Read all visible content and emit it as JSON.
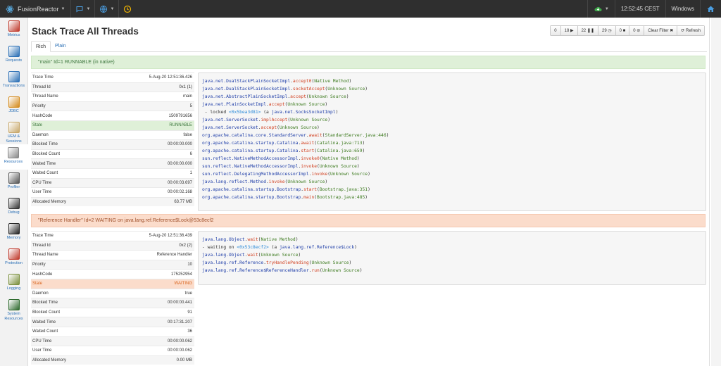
{
  "app": {
    "name": "FusionReactor",
    "time": "12:52:45 CEST",
    "os": "Windows"
  },
  "topbar_icons": [
    "atom-logo-icon",
    "chat-icon",
    "globe-icon",
    "clock-icon",
    "cloud-status-icon",
    "home-icon"
  ],
  "sidebar": {
    "items": [
      {
        "label": "Metrics",
        "icon": "metrics-icon",
        "color": "#c0392b"
      },
      {
        "label": "Requests",
        "icon": "requests-icon",
        "color": "#2a6fb5"
      },
      {
        "label": "Transactions",
        "icon": "transactions-icon",
        "color": "#2a6fb5"
      },
      {
        "label": "JDBC",
        "icon": "jdbc-icon",
        "color": "#d48a1a"
      },
      {
        "label": "UEM & Sessions",
        "icon": "uem-icon",
        "color": "#c8a86b"
      },
      {
        "label": "Resources",
        "icon": "resources-icon",
        "color": "#888888"
      },
      {
        "label": "Profiler",
        "icon": "profiler-icon",
        "color": "#555555"
      },
      {
        "label": "Debug",
        "icon": "debug-icon",
        "color": "#333333"
      },
      {
        "label": "Memory",
        "icon": "memory-icon",
        "color": "#222222"
      },
      {
        "label": "Protection",
        "icon": "protection-icon",
        "color": "#c0392b"
      },
      {
        "label": "Logging",
        "icon": "logging-icon",
        "color": "#7a8f3c"
      },
      {
        "label": "System Resources",
        "icon": "system-resources-icon",
        "color": "#2d6a2d"
      }
    ]
  },
  "page": {
    "title": "Stack Trace All Threads"
  },
  "toolbar": [
    {
      "label": "0",
      "icon": "blocked-icon"
    },
    {
      "label": "18 ▶",
      "icon": "running-icon"
    },
    {
      "label": "22 ❚❚",
      "icon": "waiting-icon"
    },
    {
      "label": "29 ◷",
      "icon": "timed-waiting-icon"
    },
    {
      "label": "0 ■",
      "icon": "terminated-icon"
    },
    {
      "label": "0 ⊘",
      "icon": "new-icon"
    },
    {
      "label": "Clear Filter ✖",
      "icon": "clear-icon"
    },
    {
      "label": "⟳ Refresh",
      "icon": "refresh-icon"
    }
  ],
  "tabs": [
    {
      "label": "Rich",
      "active": true
    },
    {
      "label": "Plain",
      "active": false
    }
  ],
  "threads": [
    {
      "header": "\"main\" Id=1 RUNNABLE (in native)",
      "info": [
        {
          "k": "Trace Time",
          "v": "5-Aug-20 12:51:36.426"
        },
        {
          "k": "Thread Id",
          "v": "0x1 (1)"
        },
        {
          "k": "Thread Name",
          "v": "main"
        },
        {
          "k": "Priority",
          "v": "5"
        },
        {
          "k": "HashCode",
          "v": "1509791656"
        },
        {
          "k": "State",
          "v": "RUNNABLE"
        },
        {
          "k": "Daemon",
          "v": "false"
        },
        {
          "k": "Blocked Time",
          "v": "00:00:00.000"
        },
        {
          "k": "Blocked Count",
          "v": "6"
        },
        {
          "k": "Waited Time",
          "v": "00:00:00.000"
        },
        {
          "k": "Waited Count",
          "v": "1"
        },
        {
          "k": "CPU Time",
          "v": "00:00:03.697"
        },
        {
          "k": "User Time",
          "v": "00:00:02.168"
        },
        {
          "k": "Allocated Memory",
          "v": "63.77 MB"
        }
      ],
      "trace": [
        {
          "c": "java.net.DualStackPlainSocketImpl",
          "m": "accept0",
          "s": "Native Method"
        },
        {
          "c": "java.net.DualStackPlainSocketImpl",
          "m": "socketAccept",
          "s": "Unknown Source"
        },
        {
          "c": "java.net.AbstractPlainSocketImpl",
          "m": "accept",
          "s": "Unknown Source"
        },
        {
          "c": "java.net.PlainSocketImpl",
          "m": "accept",
          "s": "Unknown Source"
        },
        {
          "lock": true,
          "pre": " - locked ",
          "hex": "<0x5bea3d81>",
          "obj": "java.net.SocksSocketImpl"
        },
        {
          "c": "java.net.ServerSocket",
          "m": "implAccept",
          "s": "Unknown Source"
        },
        {
          "c": "java.net.ServerSocket",
          "m": "accept",
          "s": "Unknown Source"
        },
        {
          "c": "org.apache.catalina.core.StandardServer",
          "m": "await",
          "s": "StandardServer.java:446"
        },
        {
          "c": "org.apache.catalina.startup.Catalina",
          "m": "await",
          "s": "Catalina.java:713"
        },
        {
          "c": "org.apache.catalina.startup.Catalina",
          "m": "start",
          "s": "Catalina.java:659"
        },
        {
          "c": "sun.reflect.NativeMethodAccessorImpl",
          "m": "invoke0",
          "s": "Native Method"
        },
        {
          "c": "sun.reflect.NativeMethodAccessorImpl",
          "m": "invoke",
          "s": "Unknown Source"
        },
        {
          "c": "sun.reflect.DelegatingMethodAccessorImpl",
          "m": "invoke",
          "s": "Unknown Source"
        },
        {
          "c": "java.lang.reflect.Method",
          "m": "invoke",
          "s": "Unknown Source"
        },
        {
          "c": "org.apache.catalina.startup.Bootstrap",
          "m": "start",
          "s": "Bootstrap.java:351"
        },
        {
          "c": "org.apache.catalina.startup.Bootstrap",
          "m": "main",
          "s": "Bootstrap.java:485"
        }
      ]
    },
    {
      "header": "\"Reference Handler\" Id=2 WAITING on java.lang.ref.Reference$Lock@53c8ecf2",
      "info": [
        {
          "k": "Trace Time",
          "v": "5-Aug-20 12:51:36.439"
        },
        {
          "k": "Thread Id",
          "v": "0x2 (2)"
        },
        {
          "k": "Thread Name",
          "v": "Reference Handler"
        },
        {
          "k": "Priority",
          "v": "10"
        },
        {
          "k": "HashCode",
          "v": "175252954"
        },
        {
          "k": "State",
          "v": "WAITING"
        },
        {
          "k": "Daemon",
          "v": "true"
        },
        {
          "k": "Blocked Time",
          "v": "00:00:00.441"
        },
        {
          "k": "Blocked Count",
          "v": "91"
        },
        {
          "k": "Waited Time",
          "v": "00:17:31.207"
        },
        {
          "k": "Waited Count",
          "v": "36"
        },
        {
          "k": "CPU Time",
          "v": "00:00:00.062"
        },
        {
          "k": "User Time",
          "v": "00:00:00.062"
        },
        {
          "k": "Allocated Memory",
          "v": "0.00 MB"
        }
      ],
      "trace": [
        {
          "c": "java.lang.Object",
          "m": "wait",
          "s": "Native Method"
        },
        {
          "lock": true,
          "pre": "- waiting on ",
          "hex": "<0x53c8ecf2>",
          "obj": "java.lang.ref.Reference$Lock"
        },
        {
          "c": "java.lang.Object",
          "m": "wait",
          "s": "Unknown Source"
        },
        {
          "c": "java.lang.ref.Reference",
          "m": "tryHandlePending",
          "s": "Unknown Source"
        },
        {
          "c": "java.lang.ref.Reference$ReferenceHandler",
          "m": "run",
          "s": "Unknown Source"
        }
      ]
    }
  ]
}
